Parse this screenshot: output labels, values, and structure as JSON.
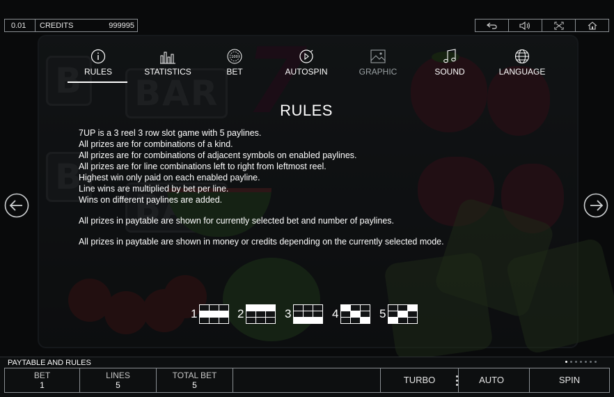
{
  "header": {
    "bet_value": "0.01",
    "credits_label": "CREDITS",
    "credits_value": "999995",
    "toolbar_icons": [
      "back-icon",
      "sound-icon",
      "fullscreen-icon",
      "home-icon"
    ]
  },
  "tabs": [
    {
      "label": "RULES",
      "icon": "info-icon",
      "active": true
    },
    {
      "label": "STATISTICS",
      "icon": "bar-chart-icon",
      "active": false
    },
    {
      "label": "BET",
      "icon": "chip-icon",
      "active": false
    },
    {
      "label": "AUTOSPIN",
      "icon": "play-cycle-icon",
      "active": false
    },
    {
      "label": "GRAPHIC",
      "icon": "image-icon",
      "active": false
    },
    {
      "label": "SOUND",
      "icon": "music-note-icon",
      "active": false
    },
    {
      "label": "LANGUAGE",
      "icon": "globe-icon",
      "active": false
    }
  ],
  "rules": {
    "title": "RULES",
    "lines": [
      "7UP is a 3 reel 3 row slot game with 5 paylines.",
      "All prizes are for combinations of a kind.",
      "All prizes are for combinations of adjacent symbols on enabled paylines.",
      "All prizes are for line combinations left to right from leftmost reel.",
      "Highest win only paid on each enabled payline.",
      "Line wins are multiplied by bet per line.",
      "Wins on different paylines are added."
    ],
    "note_1": "All prizes in paytable are shown for currently selected bet and number of paylines.",
    "note_2": "All prizes in paytable are shown in money or credits depending on the currently selected mode."
  },
  "paylines": [
    {
      "number": "1",
      "cells": [
        0,
        0,
        0,
        1,
        1,
        1,
        0,
        0,
        0
      ]
    },
    {
      "number": "2",
      "cells": [
        1,
        1,
        1,
        0,
        0,
        0,
        0,
        0,
        0
      ]
    },
    {
      "number": "3",
      "cells": [
        0,
        0,
        0,
        0,
        0,
        0,
        1,
        1,
        1
      ]
    },
    {
      "number": "4",
      "cells": [
        1,
        0,
        0,
        0,
        1,
        0,
        0,
        0,
        1
      ]
    },
    {
      "number": "5",
      "cells": [
        0,
        0,
        1,
        0,
        1,
        0,
        1,
        0,
        0
      ]
    }
  ],
  "navigation": {
    "prev_icon": "arrow-left-icon",
    "next_icon": "arrow-right-icon"
  },
  "footer": {
    "section_label": "PAYTABLE AND RULES",
    "page_dots": 7,
    "active_dot": 0,
    "bet_label": "BET",
    "bet_value": "1",
    "lines_label": "LINES",
    "lines_value": "5",
    "total_bet_label": "TOTAL BET",
    "total_bet_value": "5",
    "turbo_label": "TURBO",
    "auto_label": "AUTO",
    "spin_label": "SPIN"
  },
  "colors": {
    "accent": "#ffffff",
    "border": "#8a8f93",
    "background": "#0b0c0d"
  }
}
